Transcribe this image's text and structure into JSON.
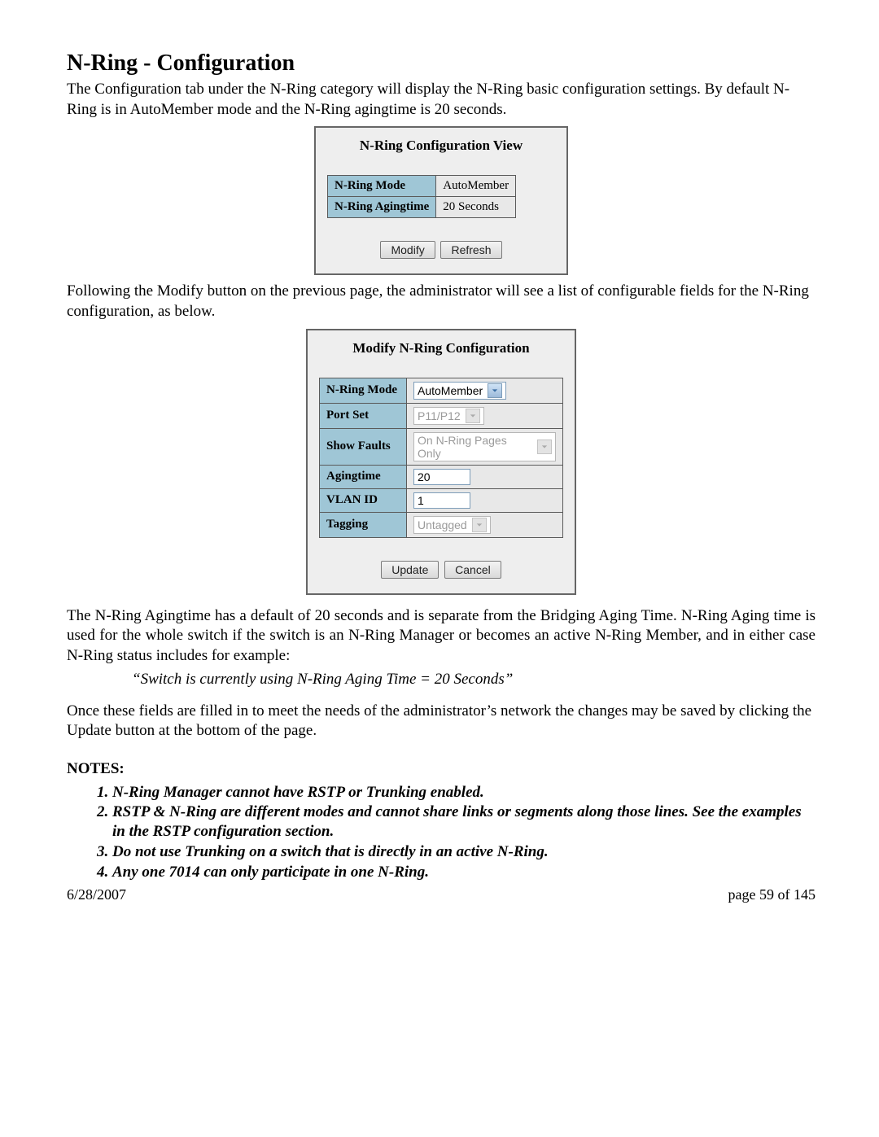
{
  "heading": "N-Ring - Configuration",
  "p1": "The Configuration tab under the N-Ring category will display the N-Ring basic configuration settings.  By default N-Ring is in AutoMember mode and the N-Ring agingtime is 20 seconds.",
  "panel1": {
    "title": "N-Ring Configuration View",
    "rows": [
      {
        "label": "N-Ring Mode",
        "value": "AutoMember"
      },
      {
        "label": "N-Ring Agingtime",
        "value": "20 Seconds"
      }
    ],
    "buttons": {
      "modify": "Modify",
      "refresh": "Refresh"
    }
  },
  "p2": "Following the Modify button on the previous page, the administrator will see a list of configurable fields for the N-Ring configuration, as below.",
  "panel2": {
    "title": "Modify N-Ring Configuration",
    "fields": {
      "mode": {
        "label": "N-Ring Mode",
        "value": "AutoMember",
        "type": "select",
        "disabled": false
      },
      "portset": {
        "label": "Port Set",
        "value": "P11/P12",
        "type": "select",
        "disabled": true
      },
      "faults": {
        "label": "Show Faults",
        "value": "On N-Ring Pages Only",
        "type": "select",
        "disabled": true
      },
      "aging": {
        "label": "Agingtime",
        "value": "20",
        "type": "input",
        "disabled": false
      },
      "vlan": {
        "label": "VLAN ID",
        "value": "1",
        "type": "input",
        "disabled": false
      },
      "tagging": {
        "label": "Tagging",
        "value": "Untagged",
        "type": "select",
        "disabled": true
      }
    },
    "buttons": {
      "update": "Update",
      "cancel": "Cancel"
    }
  },
  "p3": "The N-Ring Agingtime has a default of 20 seconds and is separate from the Bridging Aging Time.  N-Ring Aging time is used for the whole switch if the switch is an N-Ring Manager or becomes an active N-Ring Member, and in either case N-Ring status includes for example:",
  "quote": "“Switch is currently using N-Ring Aging Time = 20 Seconds”",
  "p4": "Once these fields are filled in to meet the needs of the administrator’s network the changes may be saved by clicking the Update button at the bottom of the page.",
  "notes_h": "NOTES:",
  "notes": [
    "N-Ring Manager cannot have RSTP or Trunking enabled.",
    "RSTP & N-Ring are different modes and cannot share links or segments along those lines.  See the examples in the RSTP configuration section.",
    "Do not use Trunking on a switch that is directly in an active N-Ring.",
    "Any one 7014 can only participate in one N-Ring."
  ],
  "footer": {
    "date": "6/28/2007",
    "page": "page 59 of 145"
  }
}
